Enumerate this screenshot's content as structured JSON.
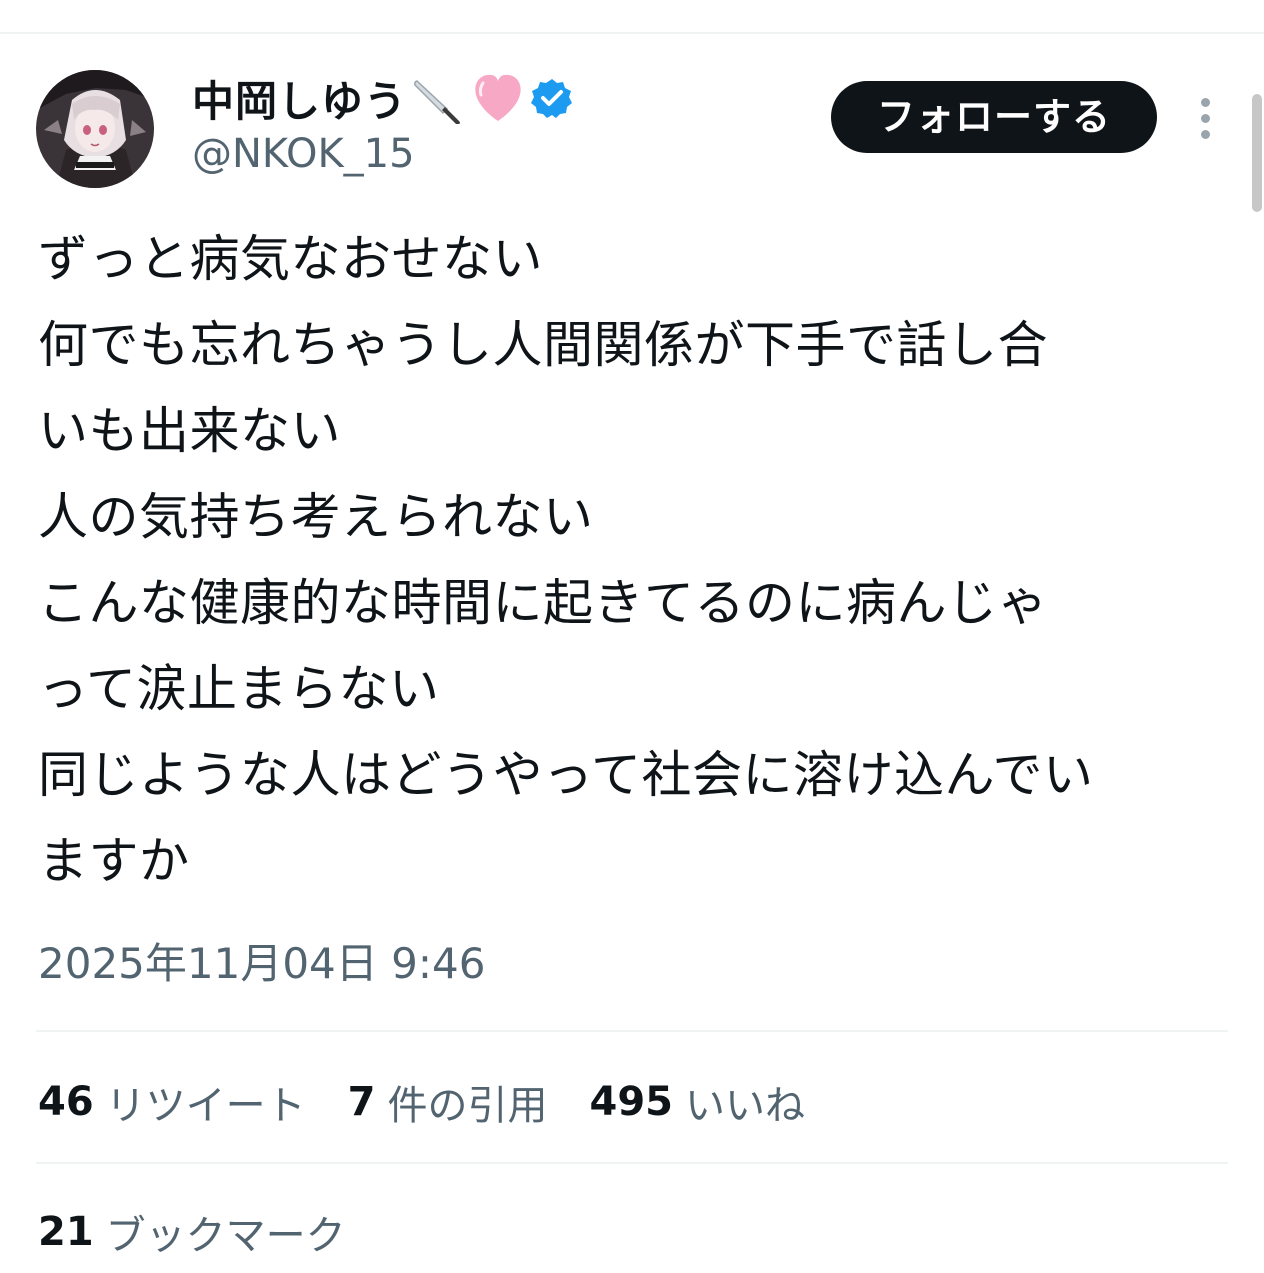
{
  "author": {
    "display_name": "中岡しゆう",
    "handle": "@NKOK_15",
    "name_icons": [
      "knife-icon",
      "pink-heart-icon",
      "verified-badge-icon"
    ]
  },
  "follow_label": "フォローする",
  "tweet": {
    "lines": [
      "ずっと病気なおせない",
      "何でも忘れちゃうし人間関係が下手で話し合",
      "いも出来ない",
      "人の気持ち考えられない",
      "こんな健康的な時間に起きてるのに病んじゃ",
      "って涙止まらない",
      "同じような人はどうやって社会に溶け込んでい",
      "ますか"
    ],
    "timestamp": "2025年11月04日 9:46"
  },
  "stats": {
    "retweets": {
      "count": "46",
      "label": "リツイート"
    },
    "quotes": {
      "count": "7",
      "label": "件の引用"
    },
    "likes": {
      "count": "495",
      "label": "いいね"
    },
    "bookmarks": {
      "count": "21",
      "label": "ブックマーク"
    }
  },
  "colors": {
    "text_primary": "#0f1419",
    "text_secondary": "#536471",
    "follow_button_bg": "#0f1419",
    "verified_badge": "#1d9bf0",
    "divider": "#eff3f4"
  }
}
